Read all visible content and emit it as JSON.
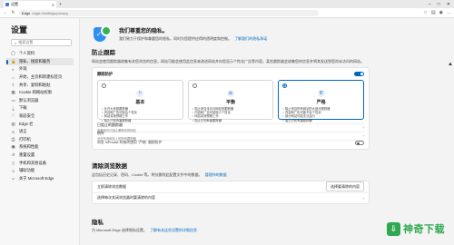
{
  "browser": {
    "tab_title": "设置",
    "url_scheme": "Edge",
    "url_path": "edge://settings/privacy"
  },
  "sidebar": {
    "title": "设置",
    "search_placeholder": "搜索设置",
    "items": [
      {
        "label": "个人资料",
        "icon": "profile-icon"
      },
      {
        "label": "隐私、搜索和服务",
        "icon": "lock-icon",
        "active": true
      },
      {
        "label": "外观",
        "icon": "appearance-icon"
      },
      {
        "label": "开始、主页和新建标签页",
        "icon": "home-icon"
      },
      {
        "label": "共享、复制和粘贴",
        "icon": "share-icon"
      },
      {
        "label": "Cookie 和网站权限",
        "icon": "cookie-icon"
      },
      {
        "label": "默认浏览器",
        "icon": "browser-icon"
      },
      {
        "label": "下载",
        "icon": "download-icon"
      },
      {
        "label": "家庭安全",
        "icon": "family-icon"
      },
      {
        "label": "Edge 栏",
        "icon": "edge-bar-icon"
      },
      {
        "label": "语言",
        "icon": "language-icon"
      },
      {
        "label": "打印机",
        "icon": "printer-icon"
      },
      {
        "label": "系统和性能",
        "icon": "system-icon"
      },
      {
        "label": "重置设置",
        "icon": "reset-icon"
      },
      {
        "label": "手机和其他设备",
        "icon": "phone-icon"
      },
      {
        "label": "辅助功能",
        "icon": "accessibility-icon"
      },
      {
        "label": "关于 Microsoft Edge",
        "icon": "edge-icon"
      }
    ]
  },
  "banner": {
    "title": "我们尊重您的隐私。",
    "text": "我们致力于保护和尊重您的隐私，同时为您提供应得的透明度和控制。",
    "link": "了解我们的隐私承诺"
  },
  "tracking": {
    "title": "防止跟踪",
    "description": "网站会使用跟踪器收集有关您浏览的信息。网站可能会使用此信息来改进网站并向您显示个性化广告等内容。某些跟踪器会收集您的信息并将其发送到您尚未访问的网站。",
    "toggle_label": "跟踪防护",
    "levels": [
      {
        "name": "基本",
        "bullets": [
          "允许大多数跟踪器",
          "内容和广告可能会个性化",
          "网站将按预期工作",
          "阻止已知有害跟踪器"
        ],
        "selected": false
      },
      {
        "name": "平衡",
        "bullets": [
          "阻止来自未访问网站的跟踪器",
          "内容和广告可能较少个性化",
          "网站将按预期工作",
          "阻止已知有害跟踪器"
        ],
        "selected": false
      },
      {
        "name": "严格",
        "bullets": [
          "阻止来自所有网站的大部分跟踪器",
          "内容和广告可能不会个性化",
          "部分网站可能无法运行",
          "阻止已知有害跟踪器"
        ],
        "selected": true
      }
    ],
    "blocked_trackers": "已阻止的跟踪器",
    "blocked_trackers_sub": "查看我们已阻止跟踪你的网站",
    "exceptions": "例外",
    "exceptions_sub": "允许所选网站上的所有跟踪器",
    "inprivate": "浏览 InPrivate 时始终使用 \"严格\" 跟踪防护"
  },
  "clear_data": {
    "title": "清除浏览数据",
    "description": "这包括历史记录、密码、Cookie 等。将仅删除此配置文件中的数据。",
    "link": "管理你的数据",
    "row1": "立即清除浏览数据",
    "row1_button": "选择要清除的内容",
    "row2": "选择每次关闭浏览器时要清除的内容"
  },
  "privacy": {
    "title": "隐私",
    "description": "为 Microsoft Edge 选择隐私设置。",
    "link": "了解有关这些设置的详细信息"
  },
  "watermark": {
    "logo": "⇩",
    "text": "神奇下载"
  },
  "colors": {
    "accent": "#0067c0",
    "watermark": "#2fa84f"
  }
}
